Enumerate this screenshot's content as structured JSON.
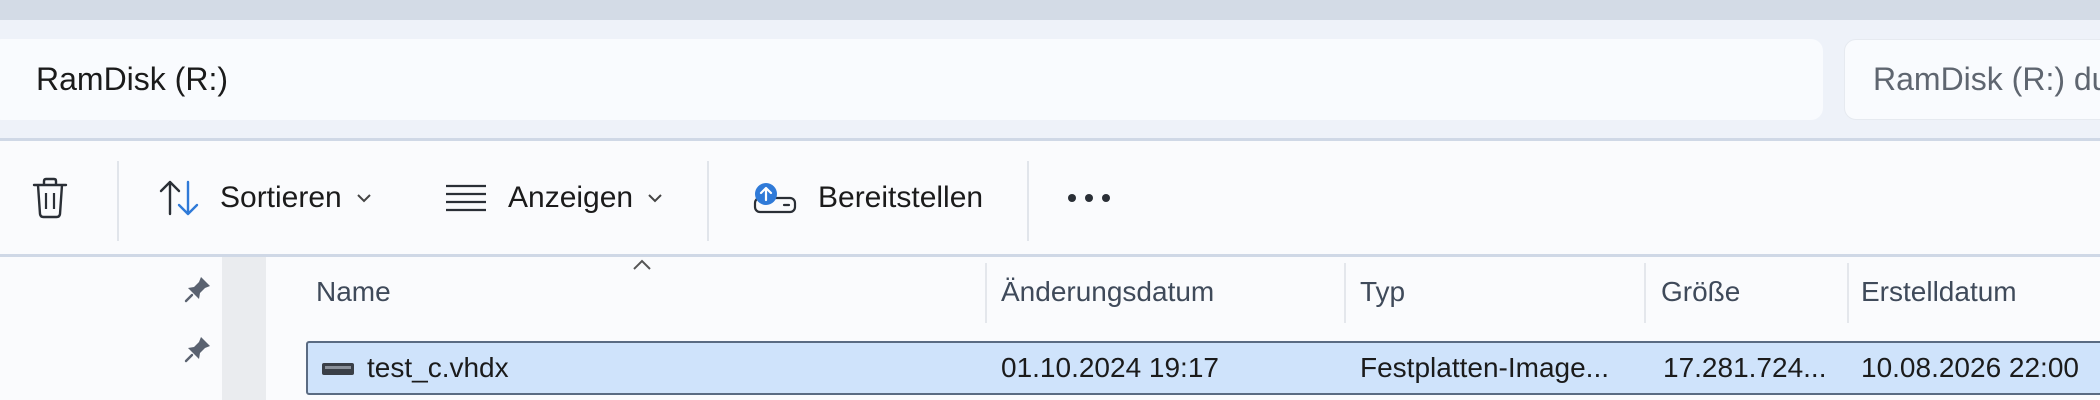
{
  "address": {
    "path": "RamDisk (R:)"
  },
  "search": {
    "placeholder": "RamDisk (R:) du"
  },
  "toolbar": {
    "delete_icon": "trash-icon",
    "sort_label": "Sortieren",
    "view_label": "Anzeigen",
    "mount_label": "Bereitstellen",
    "more_icon": "more-dots-icon"
  },
  "columns": {
    "name": "Name",
    "modified": "Änderungsdatum",
    "type": "Typ",
    "size": "Größe",
    "created": "Erstelldatum"
  },
  "files": [
    {
      "name": "test_c.vhdx",
      "modified": "01.10.2024 19:17",
      "type": "Festplatten-Image...",
      "size": "17.281.724...",
      "created": "10.08.2026 22:00",
      "icon": "drive-image-icon",
      "selected": true
    }
  ],
  "colors": {
    "accent": "#2f7ad8",
    "selection": "#cfe3fb"
  }
}
